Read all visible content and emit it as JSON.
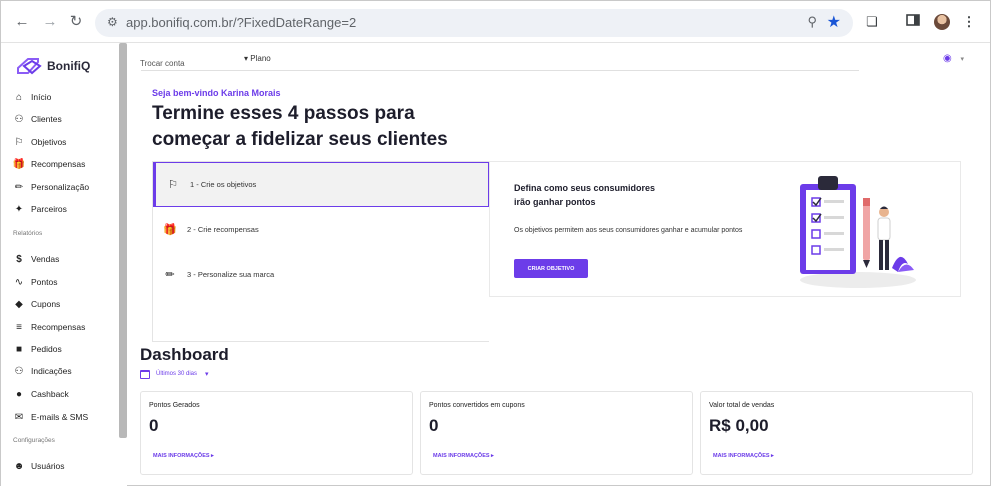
{
  "browser": {
    "url": "app.bonifiq.com.br/?FixedDateRange=2"
  },
  "brand": {
    "name": "BonifiQ"
  },
  "sidebar": {
    "items": [
      {
        "label": "Início",
        "icon": "home-icon"
      },
      {
        "label": "Clientes",
        "icon": "users-icon"
      },
      {
        "label": "Objetivos",
        "icon": "flag-icon"
      },
      {
        "label": "Recompensas",
        "icon": "gift-icon"
      },
      {
        "label": "Personalização",
        "icon": "brush-icon"
      },
      {
        "label": "Parceiros",
        "icon": "handshake-icon"
      }
    ],
    "reports_header": "Relatórios",
    "reports": [
      {
        "label": "Vendas",
        "icon": "dollar-icon"
      },
      {
        "label": "Pontos",
        "icon": "trend-icon"
      },
      {
        "label": "Cupons",
        "icon": "tag-icon"
      },
      {
        "label": "Recompensas",
        "icon": "checklist-icon"
      },
      {
        "label": "Pedidos",
        "icon": "bag-icon"
      },
      {
        "label": "Indicações",
        "icon": "referral-icon"
      },
      {
        "label": "Cashback",
        "icon": "cashback-icon"
      },
      {
        "label": "E-mails & SMS",
        "icon": "mail-icon"
      }
    ],
    "config_header": "Configurações",
    "config": [
      {
        "label": "Usuários",
        "icon": "user-circle-icon"
      }
    ]
  },
  "topbar": {
    "switch_account": "Trocar conta",
    "plan": "Plano"
  },
  "onboarding": {
    "welcome": "Seja bem-vindo Karina Morais",
    "headline": "Termine esses 4 passos para começar a fidelizar seus clientes",
    "steps": [
      {
        "label": "1 - Crie os objetivos",
        "icon": "flag-icon"
      },
      {
        "label": "2 - Crie recompensas",
        "icon": "gift-icon"
      },
      {
        "label": "3 - Personalize sua marca",
        "icon": "brush-icon"
      }
    ],
    "detail": {
      "title": "Defina como seus consumidores irão ganhar pontos",
      "description": "Os objetivos permitem aos seus consumidores ganhar e acumular pontos",
      "cta": "CRIAR OBJETIVO"
    }
  },
  "dashboard": {
    "title": "Dashboard",
    "period": "Últimos 30 dias",
    "cards": [
      {
        "label": "Pontos Gerados",
        "value": "0",
        "link": "MAIS INFORMAÇÕES ▸"
      },
      {
        "label": "Pontos convertidos em cupons",
        "value": "0",
        "link": "MAIS INFORMAÇÕES ▸"
      },
      {
        "label": "Valor total de vendas",
        "value": "R$ 0,00",
        "link": "MAIS INFORMAÇÕES ▸"
      }
    ]
  },
  "colors": {
    "accent": "#6c3ce9",
    "text_dark": "#1d1d2b"
  }
}
